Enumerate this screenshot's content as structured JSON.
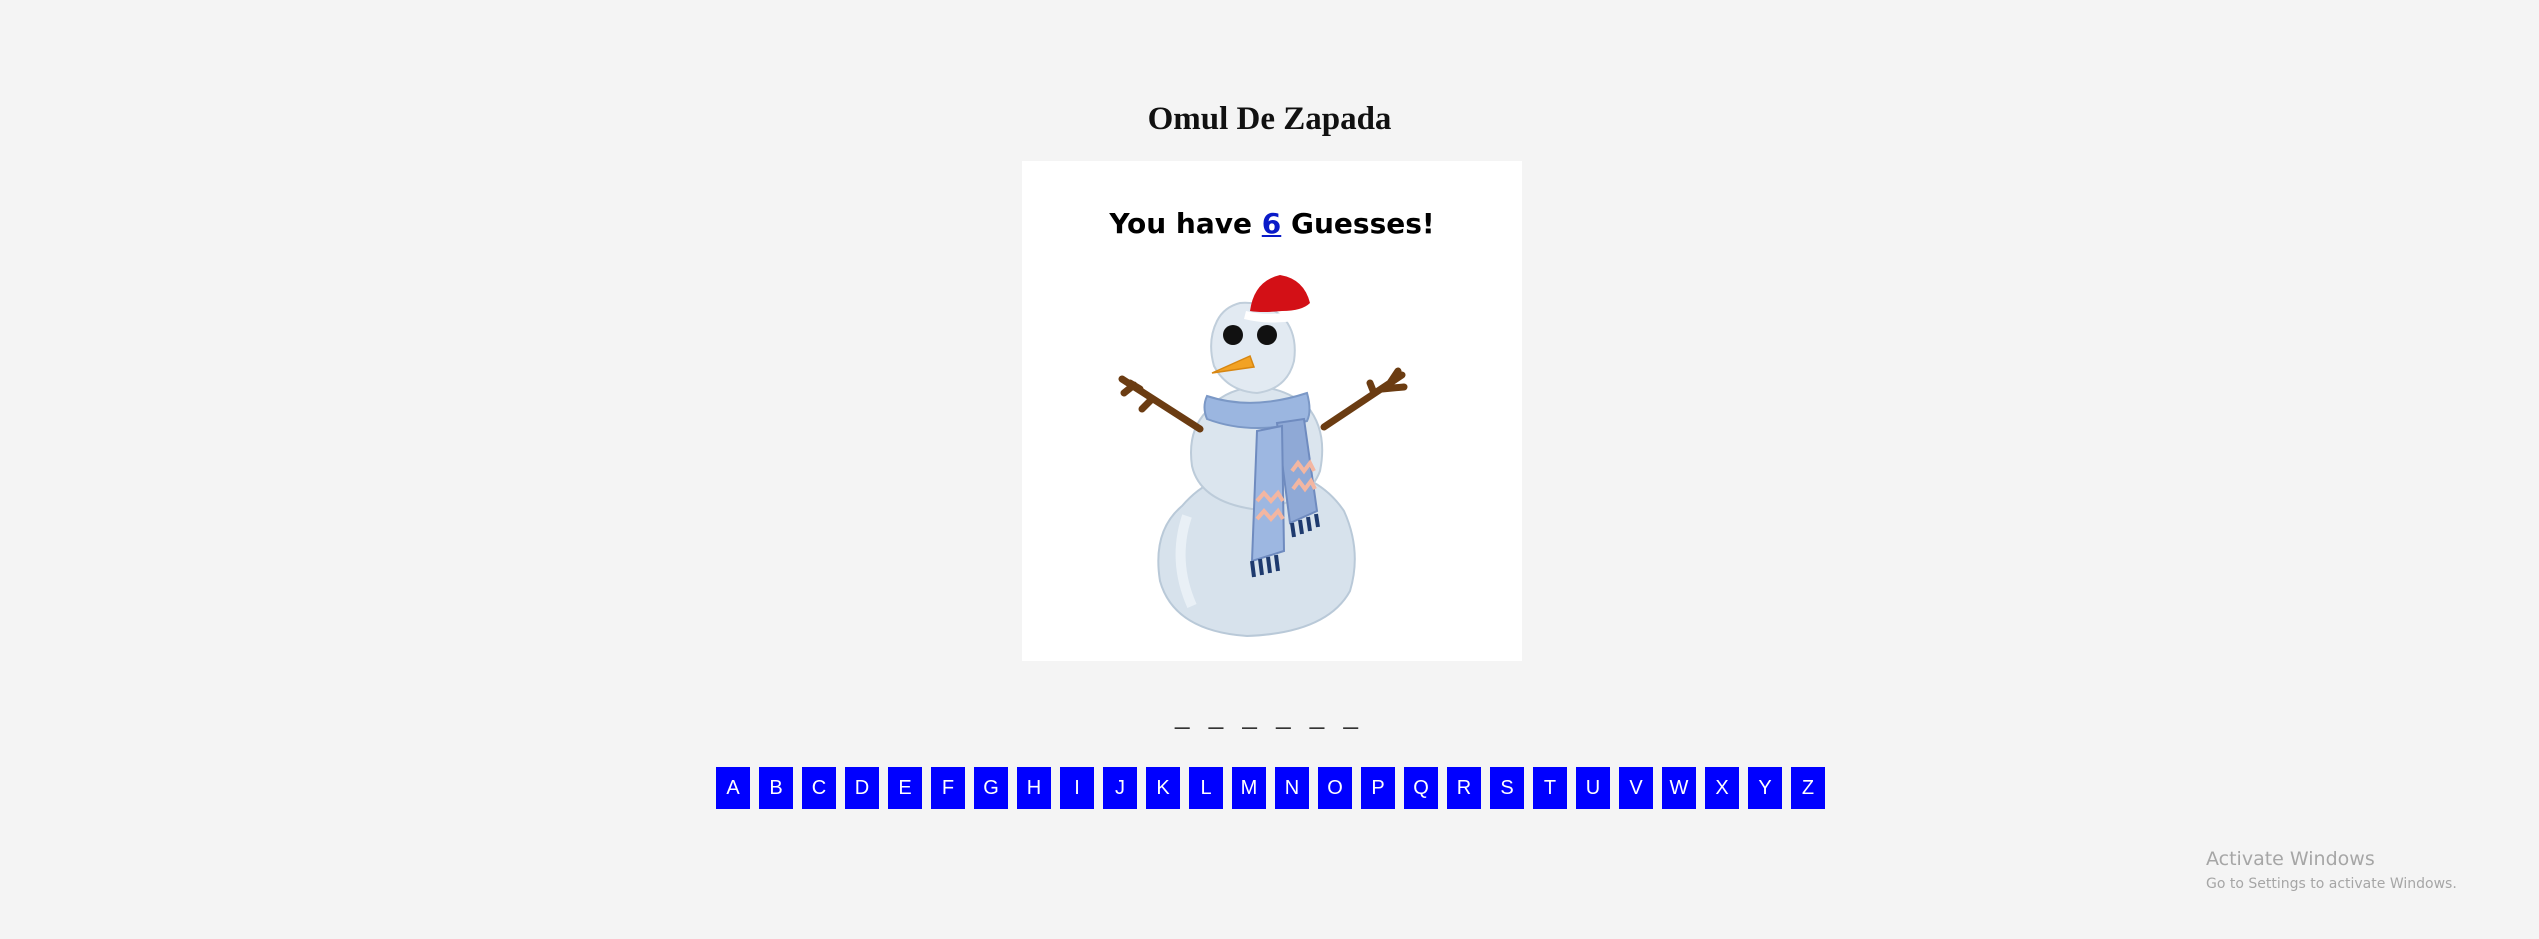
{
  "title": "Omul De Zapada",
  "guesses": {
    "prefix": "You have",
    "count": "6",
    "suffix": "Guesses!"
  },
  "word_display": "_ _ _ _ _ _",
  "letters": [
    "A",
    "B",
    "C",
    "D",
    "E",
    "F",
    "G",
    "H",
    "I",
    "J",
    "K",
    "L",
    "M",
    "N",
    "O",
    "P",
    "Q",
    "R",
    "S",
    "T",
    "U",
    "V",
    "W",
    "X",
    "Y",
    "Z"
  ],
  "colors": {
    "key_background": "#0000ff",
    "key_text": "#ffffff",
    "guess_count": "#0a1ac8",
    "page_background": "#f4f4f4"
  },
  "watermark": {
    "line1": "Activate Windows",
    "line2": "Go to Settings to activate Windows."
  }
}
